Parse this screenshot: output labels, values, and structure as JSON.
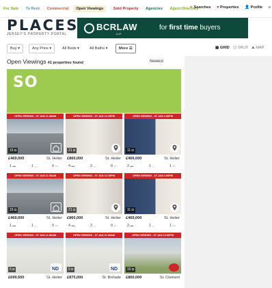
{
  "nav": {
    "left": [
      "For Sale",
      "To Rent",
      "Commercial",
      "Open Viewings",
      "Sold Property",
      "Agencies",
      "Agent Directory"
    ],
    "searches": "Searches",
    "properties": "Properties",
    "profile": "Profile"
  },
  "logo": {
    "title": "PLACES",
    "subtitle": "JERSEY'S PROPERTY PORTAL"
  },
  "banner": {
    "brand": "BCRLAW",
    "llp": "LLP",
    "tag_pre": "for ",
    "tag_bold": "first time",
    "tag_post": " buyers"
  },
  "filters": {
    "buy": "Buy",
    "price": "Any Price",
    "beds": "All Beds",
    "baths": "All Baths",
    "more": "More"
  },
  "views": {
    "grid": "GRID",
    "split": "SPLIT",
    "map": "MAP"
  },
  "results": {
    "title": "Open Viewings",
    "count": "41 properties found",
    "sort": "Newest"
  },
  "ad": {
    "text": "SO"
  },
  "cards": [
    {
      "badge": "OPEN VIEWING - 07 JAN 11:30AM",
      "photos": "15",
      "price": "£469,000",
      "location": "St. Helier",
      "beds": "1",
      "baths": "1",
      "recep": "0"
    },
    {
      "badge": "OPEN VIEWING - 07 JAN 12:15PM",
      "photos": "21",
      "price": "£860,000",
      "location": "St. Helier",
      "beds": "4",
      "baths": "2",
      "recep": "0"
    },
    {
      "badge": "OPEN VIEWING - 07 JAN 1:00PM",
      "photos": "11",
      "price": "£469,000",
      "location": "St. Helier",
      "beds": "2",
      "baths": "1",
      "recep": "1"
    },
    {
      "badge": "OPEN VIEWING - 07 JAN 11:30AM",
      "photos": "15",
      "price": "£469,000",
      "location": "St. Helier",
      "beds": "1",
      "baths": "1",
      "recep": "0"
    },
    {
      "badge": "OPEN VIEWING - 07 JAN 12:15PM",
      "photos": "21",
      "price": "£860,000",
      "location": "St. Helier",
      "beds": "4",
      "baths": "2",
      "recep": "0"
    },
    {
      "badge": "OPEN VIEWING - 07 JAN 1:00PM",
      "photos": "11",
      "price": "£469,000",
      "location": "St. Helier",
      "beds": "2",
      "baths": "1",
      "recep": "1"
    },
    {
      "badge": "OPEN VIEWING - 07 JAN 11:00AM",
      "photos": "5",
      "price": "£699,500",
      "location": "St. Helier",
      "beds": "",
      "baths": "",
      "recep": ""
    },
    {
      "badge": "OPEN VIEWING - 07 JAN 11:00AM",
      "photos": "5",
      "price": "£875,000",
      "location": "St. Brelade",
      "beds": "",
      "baths": "",
      "recep": ""
    },
    {
      "badge": "OPEN VIEWING - 07 JAN 12:00PM",
      "photos": "15",
      "price": "£860,000",
      "location": "St. Clement",
      "beds": "",
      "baths": "",
      "recep": ""
    }
  ],
  "colors": {
    "accent_red": "#d0242b",
    "banner_green": "#0d4a3b",
    "ad_green": "#9dcb4f"
  }
}
